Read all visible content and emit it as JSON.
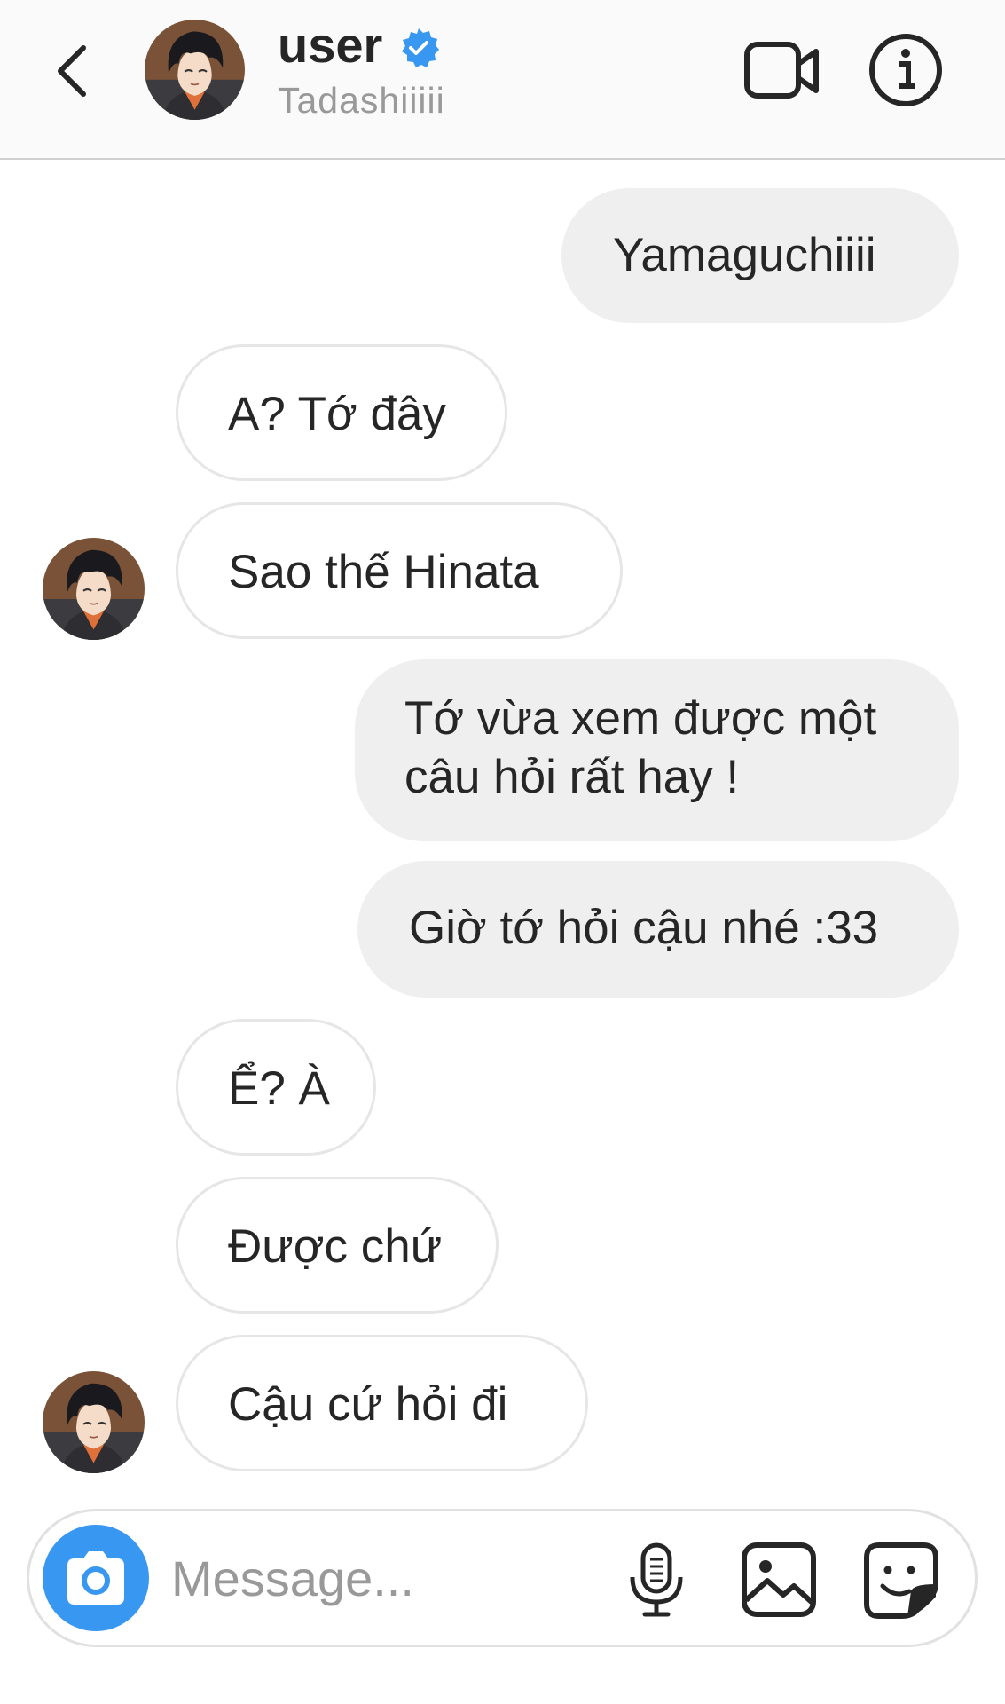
{
  "header": {
    "name": "user",
    "username": "Tadashiiiii",
    "verified": true,
    "icons": [
      "back-arrow-icon",
      "video-call-icon",
      "info-icon",
      "verified-badge-icon"
    ]
  },
  "messages": [
    {
      "side": "sent",
      "text": "Yamaguchiiii"
    },
    {
      "side": "received",
      "text": "A? Tớ đây"
    },
    {
      "side": "received",
      "text": "Sao thế Hinata"
    },
    {
      "side": "sent",
      "line1": "Tớ vừa xem được một",
      "line2": "câu hỏi rất hay !"
    },
    {
      "side": "sent",
      "text": "Giờ tớ hỏi cậu nhé :33"
    },
    {
      "side": "received",
      "text": "Ể? À"
    },
    {
      "side": "received",
      "text": "Được chứ"
    },
    {
      "side": "received",
      "text": "Cậu cứ hỏi đi"
    }
  ],
  "composer": {
    "placeholder": "Message...",
    "icons": [
      "camera-icon",
      "microphone-icon",
      "gallery-icon",
      "sticker-icon"
    ]
  },
  "colors": {
    "accent": "#3897f0",
    "sent_bubble": "#efefef",
    "received_border": "#e6e6e6",
    "secondary_text": "#999999"
  }
}
